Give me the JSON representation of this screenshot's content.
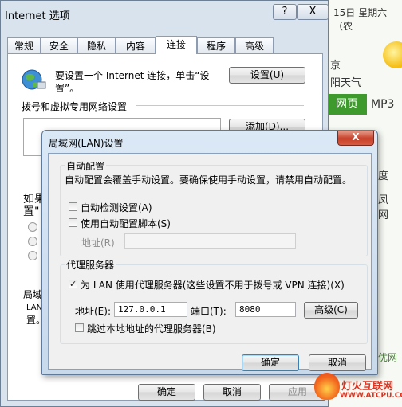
{
  "background": {
    "date_text": "15日 星期六（农",
    "weather_text": "京\n阳天气",
    "tab_web": "网页",
    "tab_mp3": "MP3",
    "misc1": "度",
    "misc2": "凤 网",
    "misc3": "优网"
  },
  "internet_options": {
    "title": "Internet 选项",
    "help_label": "?",
    "close_label": "X",
    "tabs": [
      "常规",
      "安全",
      "隐私",
      "内容",
      "连接",
      "程序",
      "高级"
    ],
    "active_tab": "连接",
    "setup_text": "要设置一个 Internet 连接，单击“设置”。",
    "setup_button": "设置(U)",
    "dialup_label": "拨号和虚拟专用网络设置",
    "add_button": "添加(D)...",
    "partial_left_1": "如果",
    "partial_left_2": "置\"",
    "partial_lan_1": "局域",
    "partial_lan_2": "LAN",
    "partial_lan_3": "置。",
    "ok_button": "确定",
    "cancel_button": "取消",
    "apply_button": "应用"
  },
  "lan_dialog": {
    "title": "局域网(LAN)设置",
    "close_label": "X",
    "auto_config": {
      "group_title": "自动配置",
      "description": "自动配置会覆盖手动设置。要确保使用手动设置，请禁用自动配置。",
      "auto_detect_label": "自动检测设置(A)",
      "auto_detect_checked": false,
      "use_script_label": "使用自动配置脚本(S)",
      "use_script_checked": false,
      "address_label": "地址(R)",
      "address_value": ""
    },
    "proxy": {
      "group_title": "代理服务器",
      "use_proxy_label": "为 LAN 使用代理服务器(这些设置不用于拨号或 VPN 连接)(X)",
      "use_proxy_checked": true,
      "address_label": "地址(E):",
      "address_value": "127.0.0.1",
      "port_label": "端口(T):",
      "port_value": "8080",
      "advanced_button": "高级(C)",
      "bypass_label": "跳过本地地址的代理服务器(B)",
      "bypass_checked": false
    },
    "ok_button": "确定",
    "cancel_button": "取消"
  },
  "watermark": {
    "name": "灯火互联网",
    "url": "WWW.ATCPU.COM"
  },
  "colors": {
    "active_tab_bg": "#3e9a2c",
    "close_red": "#c7412a",
    "watermark_red": "#e2301c"
  }
}
